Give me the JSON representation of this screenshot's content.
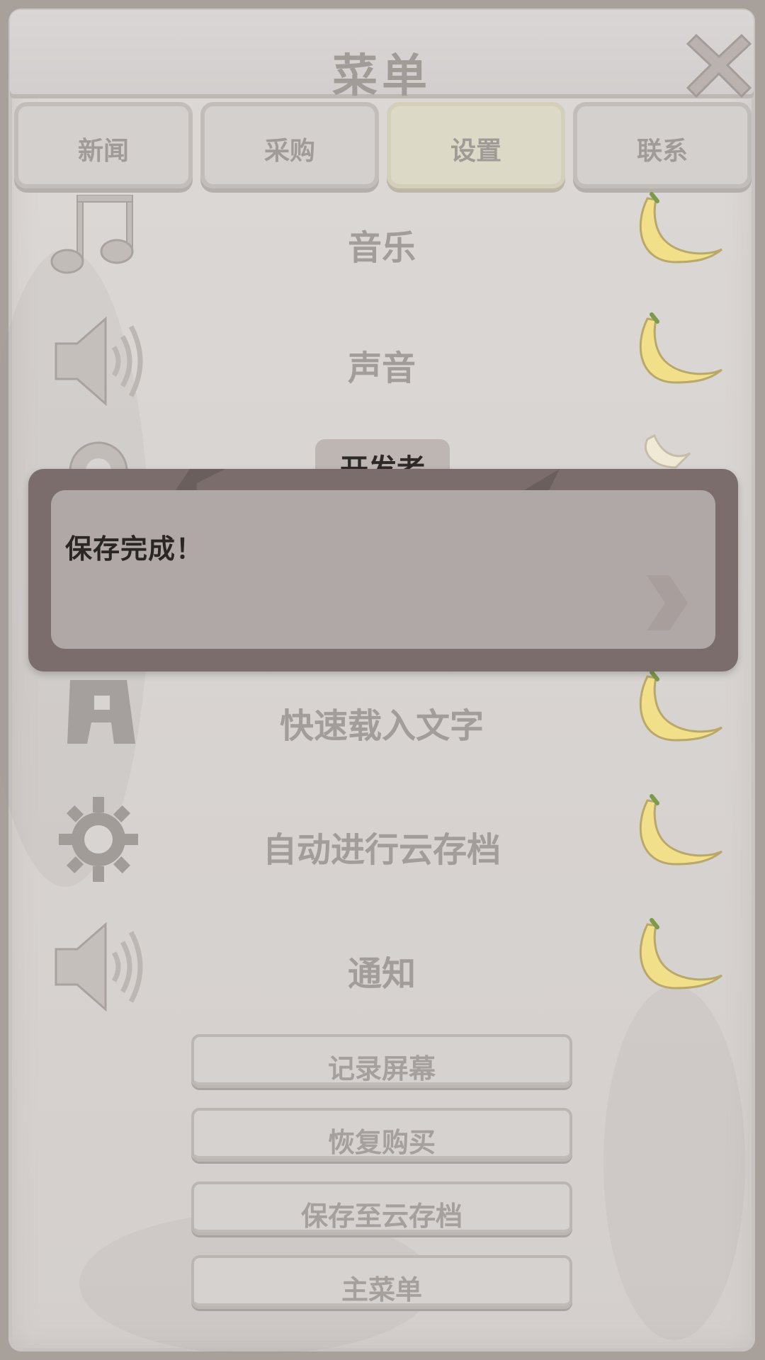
{
  "header": {
    "title": "菜单",
    "close_icon": "close-x-icon"
  },
  "tabs": [
    {
      "label": "新闻",
      "active": false
    },
    {
      "label": "采购",
      "active": false
    },
    {
      "label": "设置",
      "active": true
    },
    {
      "label": "联系",
      "active": false
    }
  ],
  "settings": [
    {
      "label": "音乐",
      "icon": "music-note-icon",
      "toggle": "banana-on"
    },
    {
      "label": "声音",
      "icon": "speaker-icon",
      "toggle": "banana-on"
    },
    {
      "label": "开发者",
      "icon": "gear-icon",
      "toggle": "banana-peeled"
    },
    {
      "label": "快速载入文字",
      "icon": "font-a-icon",
      "toggle": "banana-on"
    },
    {
      "label": "自动进行云存档",
      "icon": "gear-icon",
      "toggle": "banana-on"
    },
    {
      "label": "通知",
      "icon": "speaker-icon",
      "toggle": "banana-on"
    }
  ],
  "buttons": {
    "record_screen": "记录屏幕",
    "restore_purchase": "恢复购买",
    "save_cloud": "保存至云存档",
    "main_menu": "主菜单"
  },
  "toast": {
    "message": "保存完成！",
    "next_icon": "chevron-right-icon"
  },
  "colors": {
    "panel": "#d8d4d2",
    "text_muted": "#a29d9a",
    "toast_outer": "#7a6d6b",
    "toast_inner": "#b0a8a6",
    "active_tab": "#dcd9c6",
    "banana": "#f2df8a"
  }
}
